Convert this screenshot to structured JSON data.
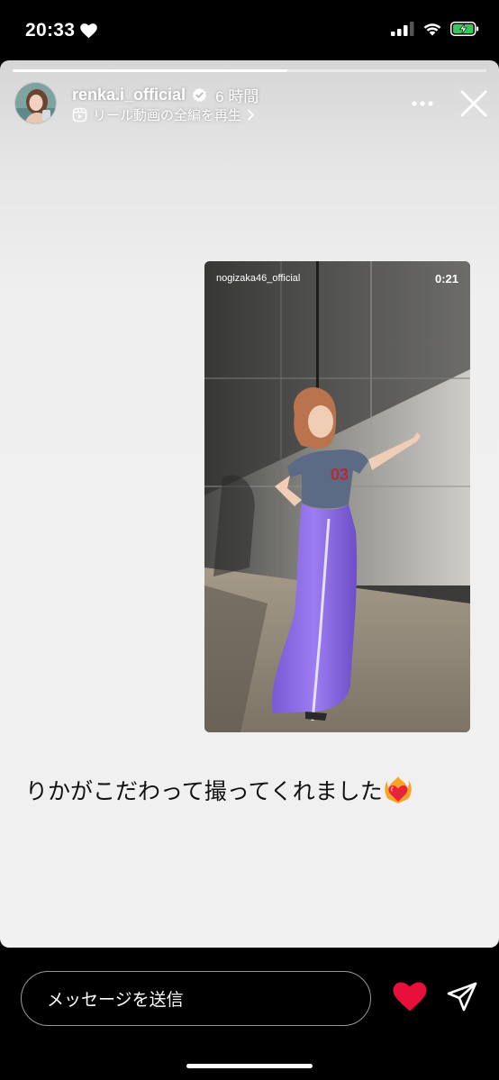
{
  "status_bar": {
    "time": "20:33"
  },
  "story": {
    "progress": 0.58,
    "username": "renka.i_official",
    "timestamp": "6 時間",
    "reel_link_label": "リール動画の全編を再生",
    "embedded_reel": {
      "account": "nogizaka46_official",
      "duration": "0:21"
    },
    "caption": "りかがこだわって撮ってくれました"
  },
  "bottom_bar": {
    "message_placeholder": "メッセージを送信"
  },
  "colors": {
    "like": "#e8103b",
    "battery": "#34c759"
  }
}
